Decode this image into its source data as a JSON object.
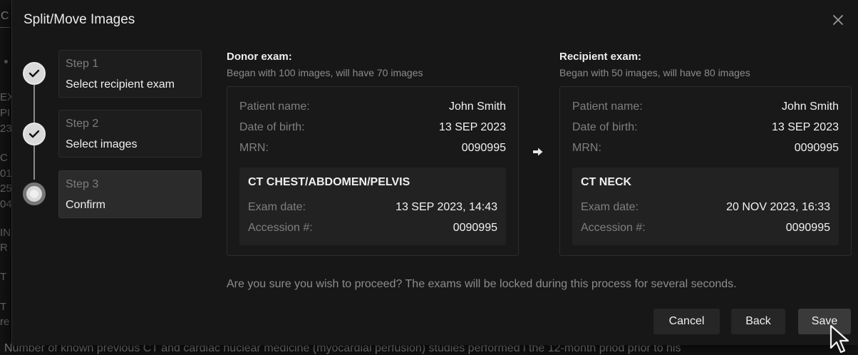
{
  "background": {
    "tab_letter": "C",
    "left_fragments": [
      "EX",
      "PI",
      "23",
      "C",
      "01",
      "25",
      "04",
      "IN",
      "R",
      "T",
      "T",
      "re"
    ],
    "bottom_text": "Number of known previous CT and cardiac nuclear medicine (myocardial perfusion) studies performed i the 12-month priod prior to his"
  },
  "dialog": {
    "title": "Split/Move Images",
    "close_icon": "close-icon"
  },
  "steps": [
    {
      "number": "Step 1",
      "label": "Select recipient exam",
      "state": "complete"
    },
    {
      "number": "Step 2",
      "label": "Select images",
      "state": "complete"
    },
    {
      "number": "Step 3",
      "label": "Confirm",
      "state": "current"
    }
  ],
  "donor": {
    "heading": "Donor exam:",
    "subtitle": "Began with 100 images, will have 70 images",
    "patient_name_label": "Patient name:",
    "patient_name": "John Smith",
    "dob_label": "Date of birth:",
    "dob": "13 SEP 2023",
    "mrn_label": "MRN:",
    "mrn": "0090995",
    "exam_title": "CT CHEST/ABDOMEN/PELVIS",
    "exam_date_label": "Exam date:",
    "exam_date": "13 SEP 2023, 14:43",
    "accession_label": "Accession #:",
    "accession": "0090995"
  },
  "recipient": {
    "heading": "Recipient exam:",
    "subtitle": "Began with 50 images, will have 80 images",
    "patient_name_label": "Patient name:",
    "patient_name": "John Smith",
    "dob_label": "Date of birth:",
    "dob": "13 SEP 2023",
    "mrn_label": "MRN:",
    "mrn": "0090995",
    "exam_title": "CT NECK",
    "exam_date_label": "Exam date:",
    "exam_date": "20 NOV 2023, 16:33",
    "accession_label": "Accession #:",
    "accession": "0090995"
  },
  "confirm_message": "Are you sure you wish to proceed?  The exams will be locked during this process for several seconds.",
  "buttons": {
    "cancel": "Cancel",
    "back": "Back",
    "save": "Save"
  }
}
